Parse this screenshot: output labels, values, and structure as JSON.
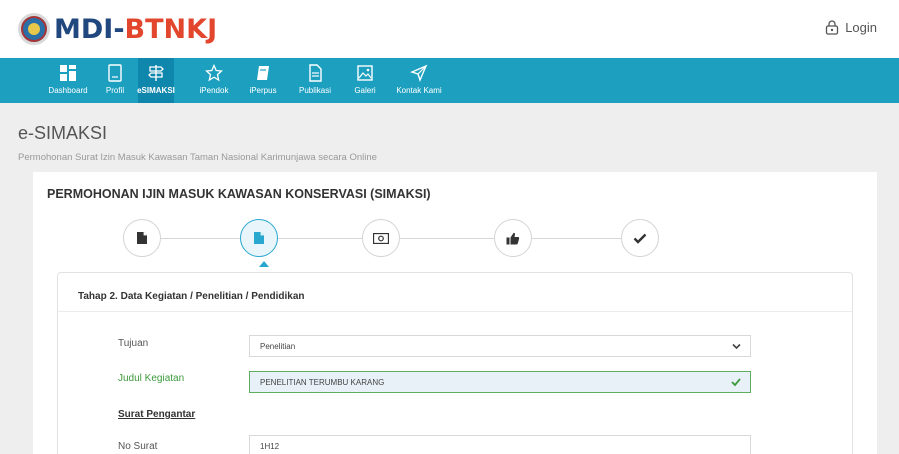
{
  "header": {
    "logo_part1": "MDI-",
    "logo_part2": "BTNKJ",
    "login_label": "Login",
    "icon": "lock-icon"
  },
  "nav": {
    "items": [
      {
        "label": "Dashboard",
        "icon": "dashboard-icon"
      },
      {
        "label": "Profil",
        "icon": "document-icon"
      },
      {
        "label": "eSIMAKSI",
        "icon": "signpost-icon",
        "active": true
      },
      {
        "label": "iPendok",
        "icon": "star-icon"
      },
      {
        "label": "iPerpus",
        "icon": "book-icon"
      },
      {
        "label": "Publikasi",
        "icon": "file-icon"
      },
      {
        "label": "Galeri",
        "icon": "image-icon"
      },
      {
        "label": "Kontak Kami",
        "icon": "paper-plane-icon"
      }
    ]
  },
  "page": {
    "title": "e-SIMAKSI",
    "subtitle": "Permohonan Surat Izin Masuk Kawasan Taman Nasional Karimunjawa secara Online"
  },
  "card": {
    "title": "PERMOHONAN IJIN MASUK KAWASAN KONSERVASI (SIMAKSI)",
    "steps": [
      {
        "icon": "document-icon",
        "active": false
      },
      {
        "icon": "document-icon",
        "active": true
      },
      {
        "icon": "money-icon",
        "active": false
      },
      {
        "icon": "thumbs-up-icon",
        "active": false
      },
      {
        "icon": "check-icon",
        "active": false
      }
    ]
  },
  "form": {
    "heading": "Tahap 2. Data Kegiatan / Penelitian / Pendidikan",
    "tujuan_label": "Tujuan",
    "tujuan_value": "Penelitian",
    "judul_label": "Judul Kegiatan",
    "judul_value": "PENELITIAN TERUMBU KARANG",
    "section_label": "Surat Pengantar",
    "nosurat_label": "No Surat",
    "nosurat_value": "1H12"
  },
  "colors": {
    "nav_bg": "#1da0c0",
    "nav_active": "#0f87ad",
    "accent": "#29a8cf",
    "valid_green": "#3c9a3c",
    "logo_blue": "#21477f",
    "logo_red": "#e2462c"
  }
}
